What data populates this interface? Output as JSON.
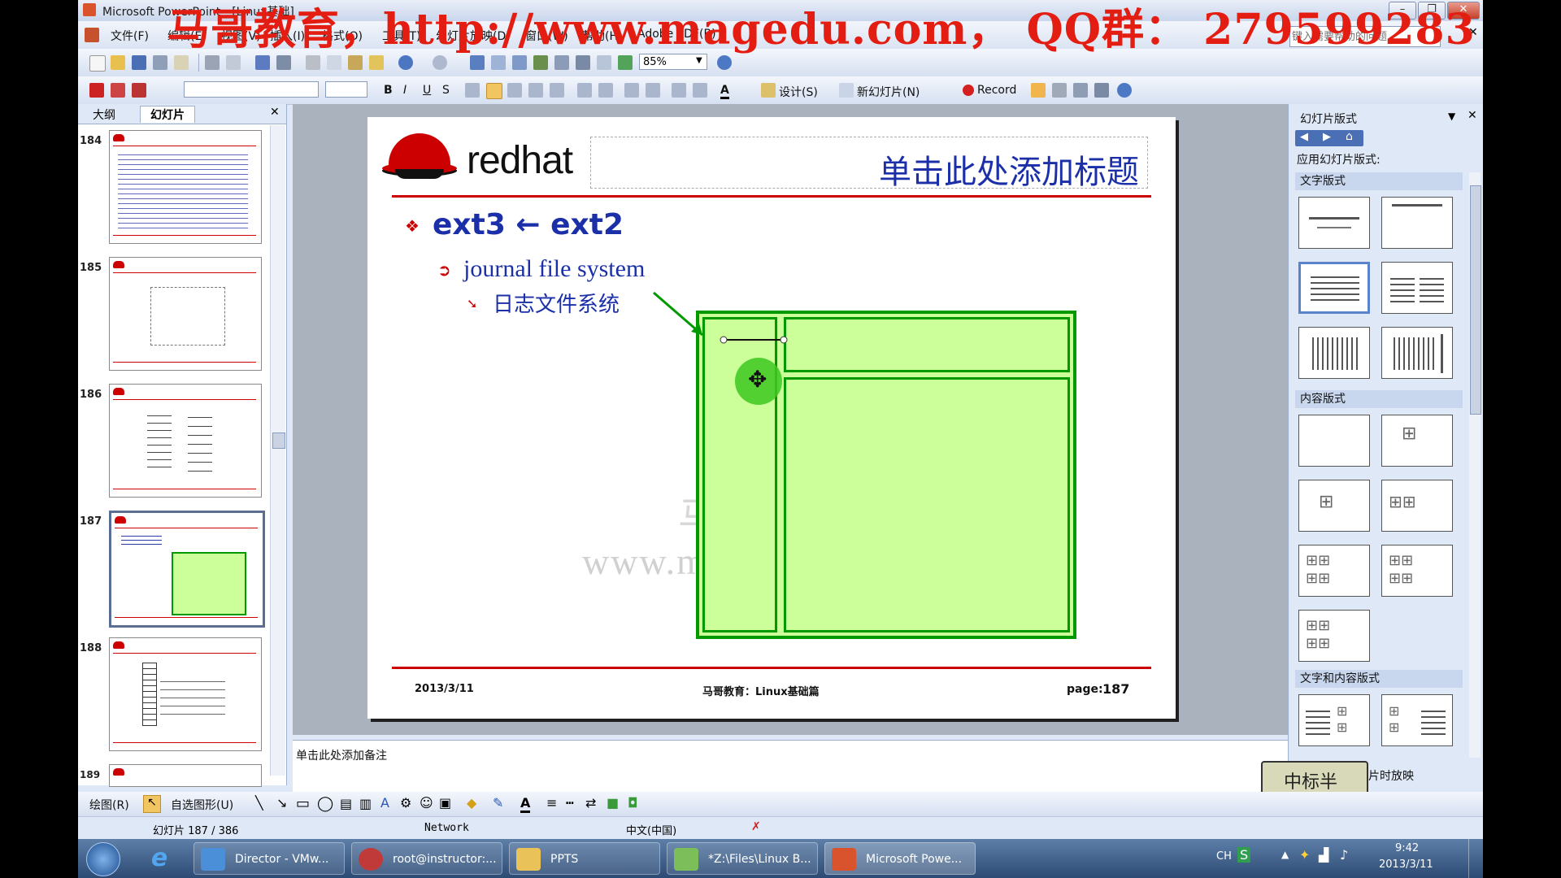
{
  "window": {
    "title": "Microsoft PowerPoint - [Linux基础]",
    "controls": [
      "–",
      "❐",
      "✕"
    ]
  },
  "watermark": "马哥教育，http://www.magedu.com， QQ群： 279599283",
  "menubar": {
    "items": [
      "文件(F)",
      "编辑(E)",
      "视图(V)",
      "插入(I)",
      "格式(O)",
      "工具(T)",
      "幻灯片放映(D)",
      "窗口(W)",
      "帮助(H)",
      "Adobe PDF(B)"
    ],
    "help_placeholder": "键入需要帮助的问题"
  },
  "toolbar1": {
    "zoom": "85%"
  },
  "toolbar2": {
    "design": "设计(S)",
    "new_slide": "新幻灯片(N)",
    "record": "Record"
  },
  "leftpane": {
    "tabs": [
      "大纲",
      "幻灯片"
    ],
    "thumbnails": [
      {
        "num": "184"
      },
      {
        "num": "185"
      },
      {
        "num": "186"
      },
      {
        "num": "187"
      },
      {
        "num": "188"
      },
      {
        "num": "189"
      }
    ]
  },
  "slide": {
    "logo_text": "redhat",
    "title_placeholder": "单击此处添加标题",
    "bullet1": "ext3 ← ext2",
    "bullet2": "journal file system",
    "bullet3": "日志文件系统",
    "watermark_fragment1": "马",
    "watermark_fragment2": "www.m",
    "footer_date": "2013/3/11",
    "footer_center": "马哥教育：Linux基础篇",
    "footer_page_label": "page:",
    "footer_page_num": "187"
  },
  "notes": {
    "placeholder": "单击此处添加备注"
  },
  "taskpane": {
    "title": "幻灯片版式",
    "apply_label": "应用幻灯片版式:",
    "section_text": "文字版式",
    "section_content": "内容版式",
    "section_text_content": "文字和内容版式",
    "bottom_label": "片时放映",
    "stamp_text": "中标半"
  },
  "drawbar": {
    "draw": "绘图(R)",
    "autoshapes": "自选图形(U)"
  },
  "statusbar": {
    "slide_count": "幻灯片 187 / 386",
    "design": "Network",
    "language": "中文(中国)"
  },
  "taskbar": {
    "items": [
      "Director - VMw...",
      "root@instructor:...",
      "PPTS",
      "*Z:\\Files\\Linux B...",
      "Microsoft Powe..."
    ],
    "ime": "CH",
    "time": "9:42",
    "date": "2013/3/11"
  },
  "colors": {
    "accent_red": "#cc0000",
    "slide_green": "#ccff99",
    "slide_green_border": "#009900",
    "title_blue": "#1a2fa8"
  }
}
